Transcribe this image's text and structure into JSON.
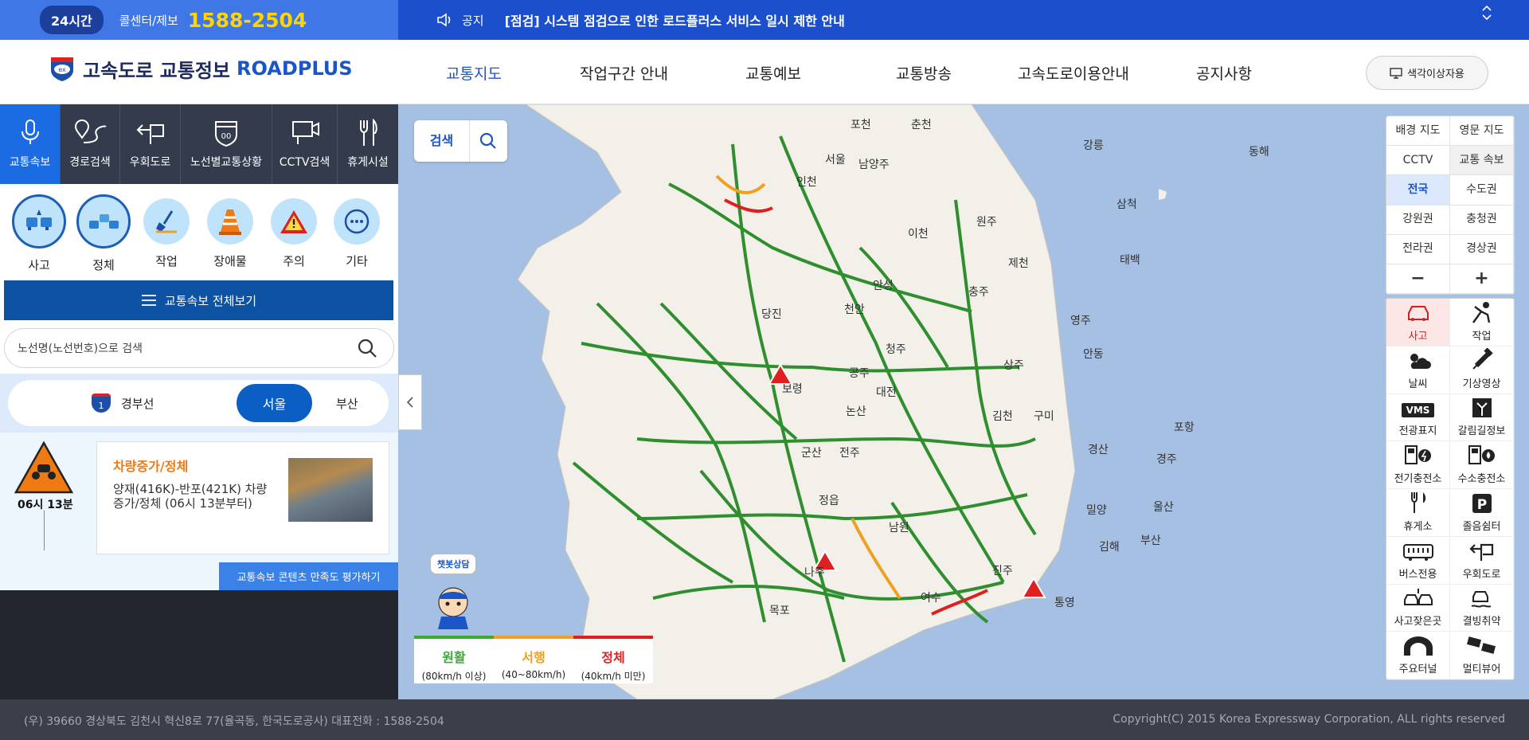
{
  "topbar": {
    "badge": "24시간",
    "call_label": "콜센터/제보",
    "call_number": "1588-2504",
    "notice_label": "공지",
    "notice_text": "[점검] 시스템 점검으로 인한 로드플러스 서비스 일시 제한 안내"
  },
  "header": {
    "logo_title": "고속도로 교통정보",
    "logo_brand": "ROADPLUS",
    "nav": [
      "교통지도",
      "작업구간 안내",
      "교통예보",
      "교통방송",
      "고속도로이용안내",
      "공지사항"
    ],
    "colorblind_button": "색각이상자용"
  },
  "sidebar": {
    "nav": [
      "교통속보",
      "경로검색",
      "우회도로",
      "노선별교통상황",
      "CCTV검색",
      "휴게시설"
    ],
    "categories": [
      "사고",
      "정체",
      "작업",
      "장애물",
      "주의",
      "기타"
    ],
    "all_button": "교통속보 전체보기",
    "search_placeholder": "노선명(노선번호)으로 검색",
    "route": {
      "number": "1",
      "name": "경부선",
      "dir_selected": "서울",
      "dir_other": "부산"
    },
    "event": {
      "time": "06시 13분",
      "title": "차량증가/정체",
      "desc": "양재(416K)-반포(421K) 차량증가/정체 (06시 13분부터)"
    },
    "eval_button": "교통속보 콘텐츠 만족도 평가하기"
  },
  "map": {
    "search_label": "검색",
    "chatbot_label": "챗봇상담",
    "legend": [
      {
        "label": "원활",
        "range": "(80km/h 이상)",
        "color": "#3aa935"
      },
      {
        "label": "서행",
        "range": "(40~80km/h)",
        "color": "#f0a020"
      },
      {
        "label": "정체",
        "range": "(40km/h 미만)",
        "color": "#e02020"
      }
    ],
    "controls": [
      "배경 지도",
      "영문 지도",
      "CCTV",
      "교통 속보",
      "전국",
      "수도권",
      "강원권",
      "충청권",
      "전라권",
      "경상권",
      "−",
      "+"
    ],
    "layers": [
      "사고",
      "작업",
      "날씨",
      "기상영상",
      "전광표지",
      "갈림길정보",
      "전기충전소",
      "수소충전소",
      "휴게소",
      "졸음쉼터",
      "버스전용",
      "우회도로",
      "사고잦은곳",
      "결빙취약",
      "주요터널",
      "멀티뷰어"
    ],
    "layers_vms_text": "VMS",
    "place_labels": [
      "포천",
      "춘천",
      "강릉",
      "동해",
      "삼척",
      "서울",
      "남양주",
      "인천",
      "이천",
      "원주",
      "제천",
      "태백",
      "안성",
      "충주",
      "당진",
      "천안",
      "영주",
      "청주",
      "안동",
      "보령",
      "공주",
      "대전",
      "상주",
      "논산",
      "김천",
      "구미",
      "포항",
      "군산",
      "전주",
      "경산",
      "경주",
      "정읍",
      "남원",
      "밀양",
      "울산",
      "김해",
      "부산",
      "나주",
      "진주",
      "여수",
      "통영",
      "목포"
    ]
  },
  "footer": {
    "address": "(우) 39660 경상북도 김천시 혁신8로 77(율곡동, 한국도로공사) 대표전화 : 1588-2504",
    "copyright": "Copyright(C) 2015 Korea Expressway Corporation, ALL rights reserved"
  }
}
